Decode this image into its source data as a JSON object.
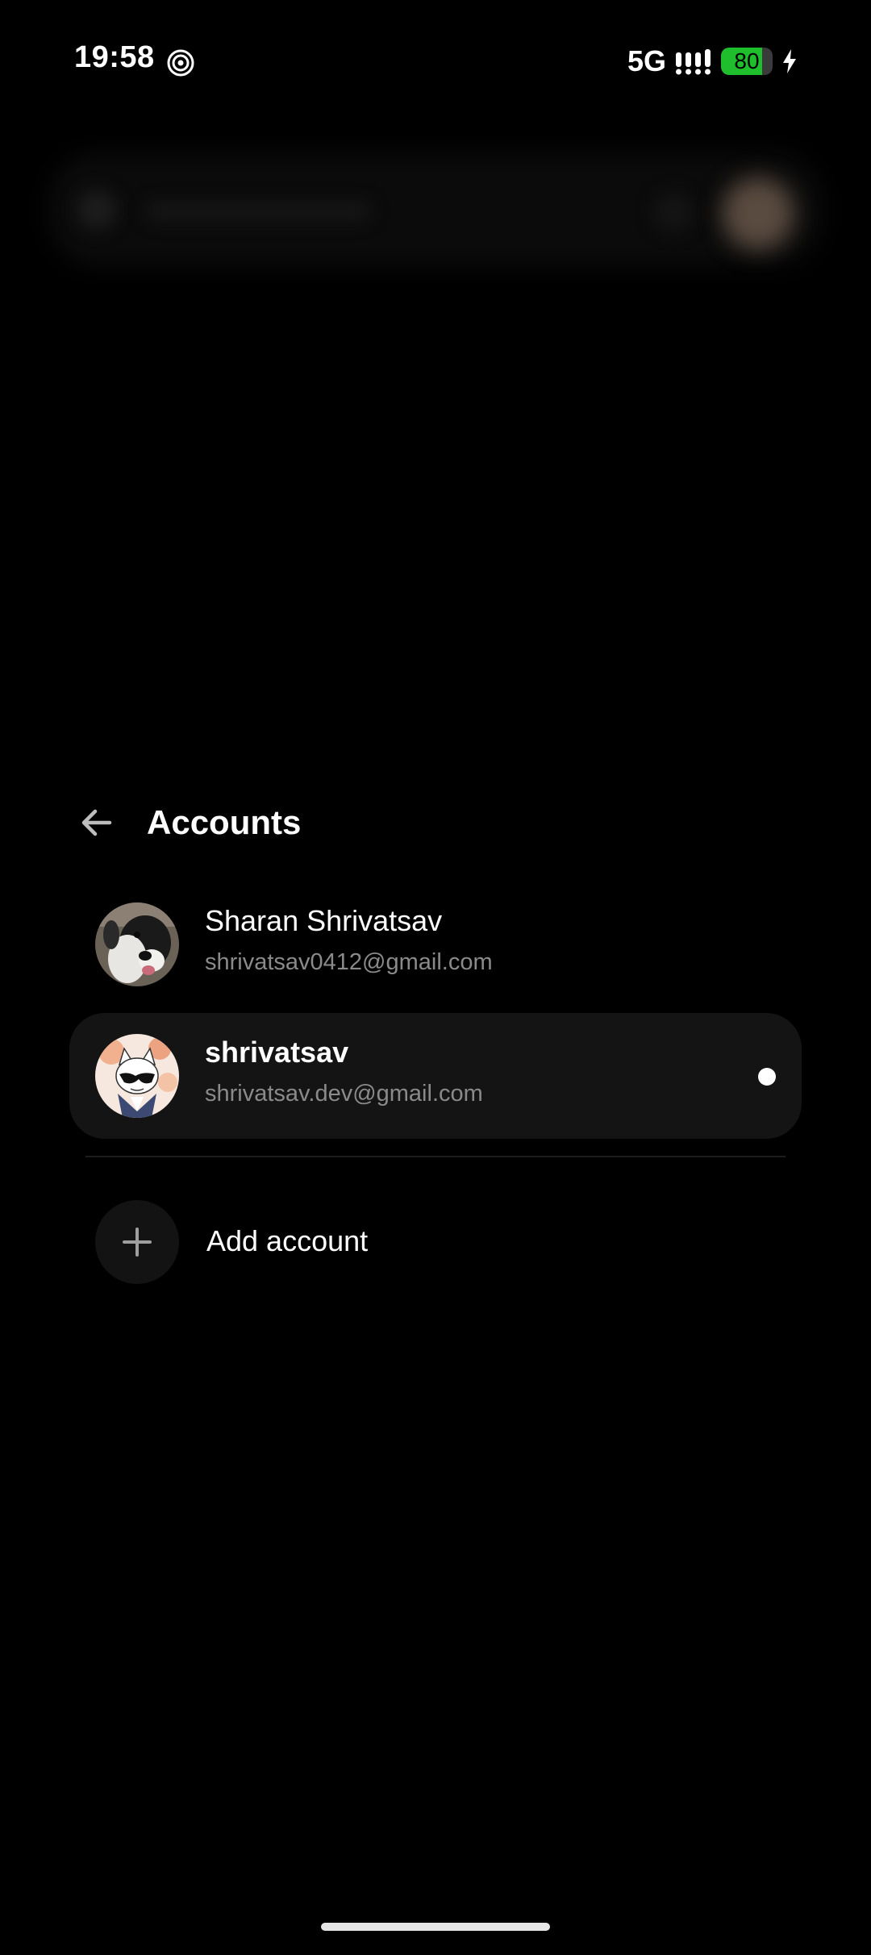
{
  "status_bar": {
    "time": "19:58",
    "network": "5G",
    "battery_level": "80",
    "battery_fraction": 0.8,
    "charging": true
  },
  "panel": {
    "title": "Accounts",
    "back_icon": "arrow-left-icon"
  },
  "accounts": [
    {
      "name": "Sharan Shrivatsav",
      "email": "shrivatsav0412@gmail.com",
      "selected": false,
      "avatar": "dog-photo"
    },
    {
      "name": "shrivatsav",
      "email": "shrivatsav.dev@gmail.com",
      "selected": true,
      "avatar": "cartoon-cat-with-sunglasses"
    }
  ],
  "add_account": {
    "label": "Add account",
    "icon": "plus-icon"
  },
  "colors": {
    "background": "#000000",
    "selected_row": "#141414",
    "secondary_text": "#8a8a8a",
    "battery_green": "#1fbe2c"
  }
}
